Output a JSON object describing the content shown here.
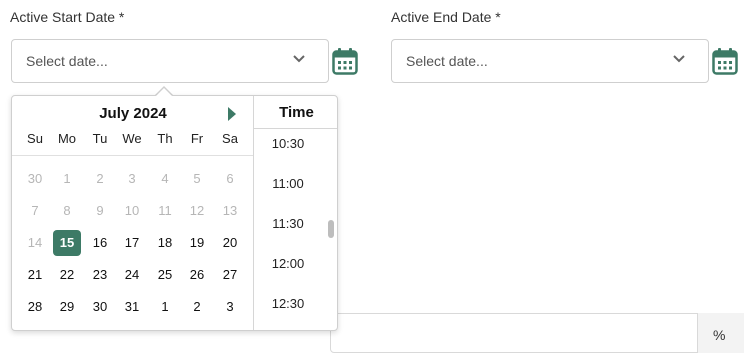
{
  "start_date": {
    "label": "Active Start Date *",
    "placeholder": "Select date..."
  },
  "end_date": {
    "label": "Active End Date *",
    "placeholder": "Select date..."
  },
  "picker": {
    "month_label": "July 2024",
    "weekdays": [
      "Su",
      "Mo",
      "Tu",
      "We",
      "Th",
      "Fr",
      "Sa"
    ],
    "weeks": [
      [
        "30",
        "1",
        "2",
        "3",
        "4",
        "5",
        "6"
      ],
      [
        "7",
        "8",
        "9",
        "10",
        "11",
        "12",
        "13"
      ],
      [
        "14",
        "15",
        "16",
        "17",
        "18",
        "19",
        "20"
      ],
      [
        "21",
        "22",
        "23",
        "24",
        "25",
        "26",
        "27"
      ],
      [
        "28",
        "29",
        "30",
        "31",
        "1",
        "2",
        "3"
      ]
    ],
    "selected_day": "15",
    "time_header": "Time",
    "times": [
      "10:30",
      "11:00",
      "11:30",
      "12:00",
      "12:30"
    ]
  },
  "bottom_field": {
    "addon": "%"
  },
  "colors": {
    "accent": "#3d7a66",
    "muted_day": "#b6b6b6"
  }
}
